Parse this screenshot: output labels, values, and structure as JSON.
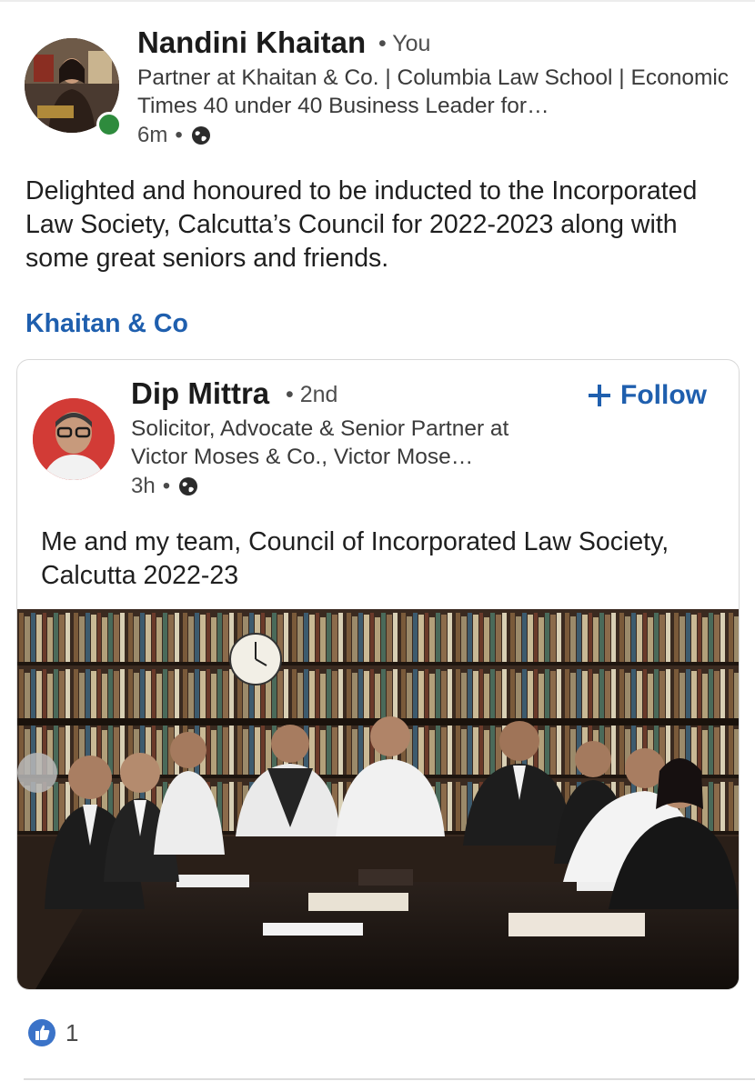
{
  "author": {
    "name": "Nandini Khaitan",
    "badge": "• You",
    "headline": "Partner at Khaitan & Co. | Columbia Law School | Economic Times 40 under 40 Business Leader for…",
    "time": "6m",
    "separator": "•",
    "visibility_icon": "globe-icon",
    "online": true,
    "online_color": "#2e8b3d"
  },
  "post": {
    "text": "Delighted and honoured to be inducted to the Incorporated Law Society, Calcutta’s Council for 2022-2023 along with some great seniors and friends.",
    "mention": "Khaitan & Co"
  },
  "reshared": {
    "name": "Dip Mittra",
    "badge": "• 2nd",
    "follow_label": "Follow",
    "headline": "Solicitor, Advocate & Senior Partner at Victor Moses & Co., Victor Mose…",
    "time": "3h",
    "separator": "•",
    "visibility_icon": "globe-icon",
    "text": "Me and my team, Council of Incorporated Law Society, Calcutta 2022-23"
  },
  "reactions": {
    "icon": "like-icon",
    "count": "1"
  },
  "colors": {
    "link": "#1f5fae",
    "online": "#2e8b3d",
    "like": "#3b73c8"
  }
}
